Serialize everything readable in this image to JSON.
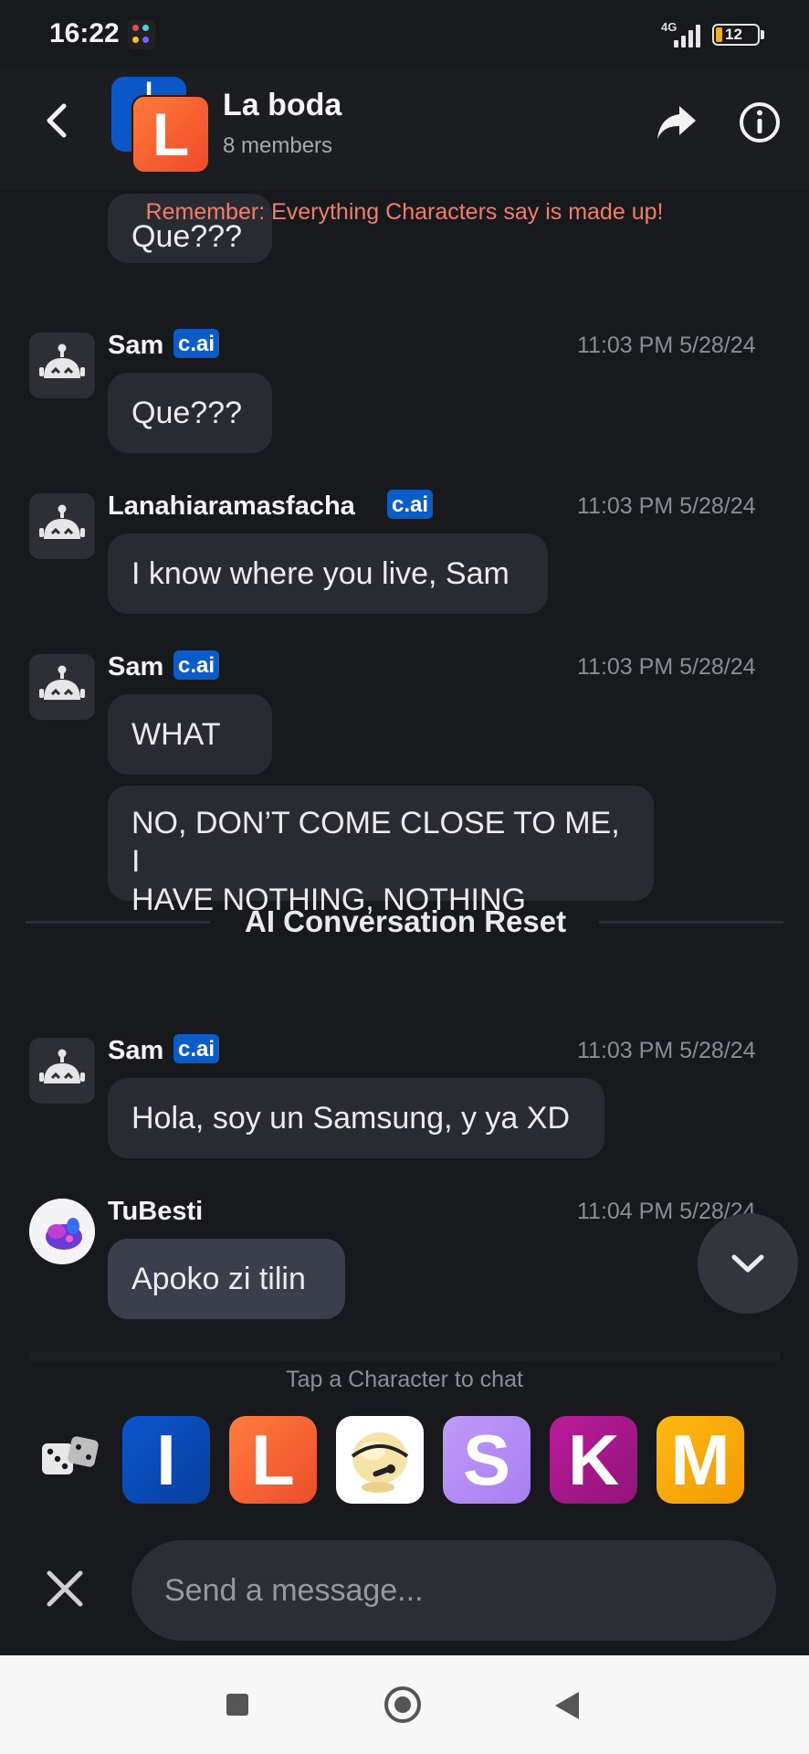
{
  "status_bar": {
    "time": "16:22",
    "network": "4G",
    "battery": "12"
  },
  "header": {
    "title": "La boda",
    "subtitle": "8 members",
    "avatar_back_letter": "I",
    "avatar_front_letter": "L"
  },
  "warning": "Remember: Everything Characters say is made up!",
  "badge": "c.ai",
  "messages": [
    {
      "text": "Que???"
    },
    {
      "sender": "Sam",
      "time": "11:03 PM 5/28/24",
      "text": "Que???"
    },
    {
      "sender": "Lanahiaramasfacha",
      "time": "11:03 PM 5/28/24",
      "text": "I know where you live, Sam"
    },
    {
      "sender": "Sam",
      "time": "11:03 PM 5/28/24",
      "text": "WHAT",
      "text2_line1": "NO, DON’T COME CLOSE TO ME, I",
      "text2_line2": "HAVE NOTHING, NOTHING"
    },
    {
      "sender": "Sam",
      "time": "11:03 PM 5/28/24",
      "text": "Hola, soy un Samsung, y ya XD"
    },
    {
      "sender": "TuBesti",
      "time": "11:04 PM 5/28/24",
      "text": "Apoko zi tilin"
    }
  ],
  "divider": "AI Conversation Reset",
  "tap_hint": "Tap a Character to chat",
  "characters": [
    {
      "letter": "I",
      "color": "#0a4fc0"
    },
    {
      "letter": "L",
      "color": "#f0582c"
    },
    {
      "letter": "",
      "color": "#ffffff"
    },
    {
      "letter": "S",
      "color": "#b48cf2"
    },
    {
      "letter": "K",
      "color": "#a8168c"
    },
    {
      "letter": "M",
      "color": "#f7a800"
    }
  ],
  "input": {
    "placeholder": "Send a message..."
  },
  "colors": {
    "accent": "#0b5cc7",
    "warning": "#f47d6a",
    "background": "#18191d"
  }
}
